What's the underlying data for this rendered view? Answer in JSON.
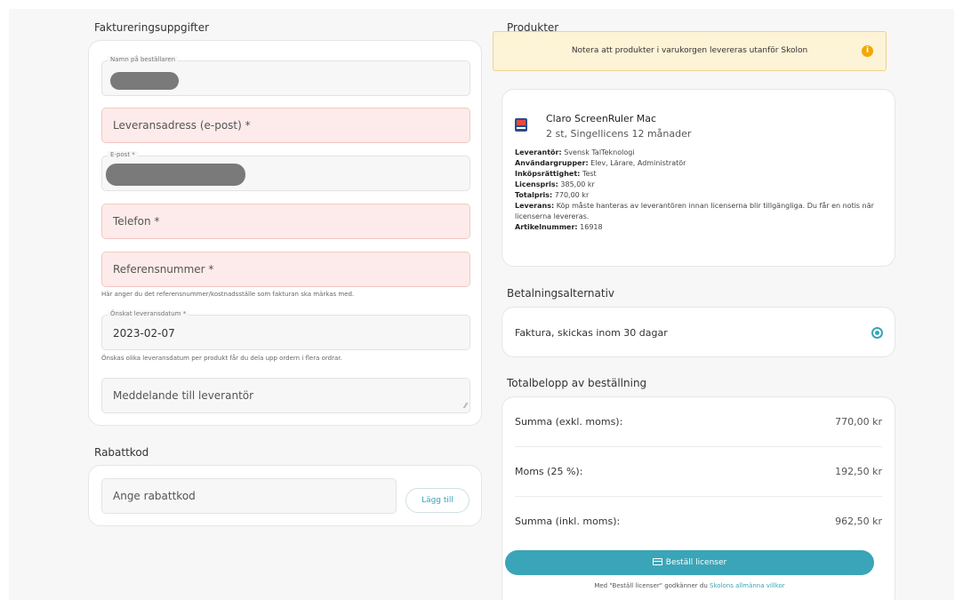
{
  "billing": {
    "title": "Faktureringsuppgifter",
    "orderer_legend": "Namn på beställaren",
    "delivery_address_placeholder": "Leveransadress (e-post) *",
    "email_legend": "E-post *",
    "phone_placeholder": "Telefon *",
    "reference_placeholder": "Referensnummer *",
    "reference_help": "Här anger du det referensnummer/kostnadsställe som fakturan ska märkas med.",
    "date_legend": "Önskat leveransdatum *",
    "date_value": "2023-02-07",
    "date_help": "Önskas olika leveransdatum per produkt får du dela upp ordern i flera ordrar.",
    "message_placeholder": "Meddelande till leverantör"
  },
  "discount": {
    "title": "Rabattkod",
    "input_placeholder": "Ange rabattkod",
    "add_label": "Lägg till"
  },
  "products": {
    "title": "Produkter",
    "notice": "Notera att produkter i varukorgen levereras utanför Skolon",
    "notice_icon": "info-icon",
    "item": {
      "name": "Claro ScreenRuler Mac",
      "subtitle": "2 st, Singellicens 12 månader",
      "supplier_label": "Leverantör:",
      "supplier": "Svensk TalTeknologi",
      "groups_label": "Användargrupper:",
      "groups": "Elev, Lärare, Administratör",
      "purchase_right_label": "Inköpsrättighet:",
      "purchase_right": "Test",
      "license_price_label": "Licenspris:",
      "license_price": "385,00 kr",
      "total_price_label": "Totalpris:",
      "total_price": "770,00 kr",
      "delivery_label": "Leverans:",
      "delivery": "Köp måste hanteras av leverantören innan licenserna blir tillgängliga. Du får en notis när licenserna levereras.",
      "article_label": "Artikelnummer:",
      "article": "16918"
    }
  },
  "payment": {
    "title": "Betalningsalternativ",
    "option": "Faktura, skickas inom 30 dagar",
    "selected": true
  },
  "totals": {
    "title": "Totalbelopp av beställning",
    "rows": [
      {
        "label": "Summa (exkl. moms):",
        "amount": "770,00 kr"
      },
      {
        "label": "Moms (25 %):",
        "amount": "192,50 kr"
      },
      {
        "label": "Summa (inkl. moms):",
        "amount": "962,50 kr"
      }
    ]
  },
  "order": {
    "button_label": "Beställ licenser",
    "button_icon": "credit-card-icon",
    "terms_prefix": "Med \"Beställ licenser\" godkänner du",
    "terms_link": "Skolons allmänna villkor"
  },
  "colors": {
    "accent": "#3aa5b8",
    "error_bg": "#fcebea",
    "notice_bg": "#fdf3d6"
  }
}
